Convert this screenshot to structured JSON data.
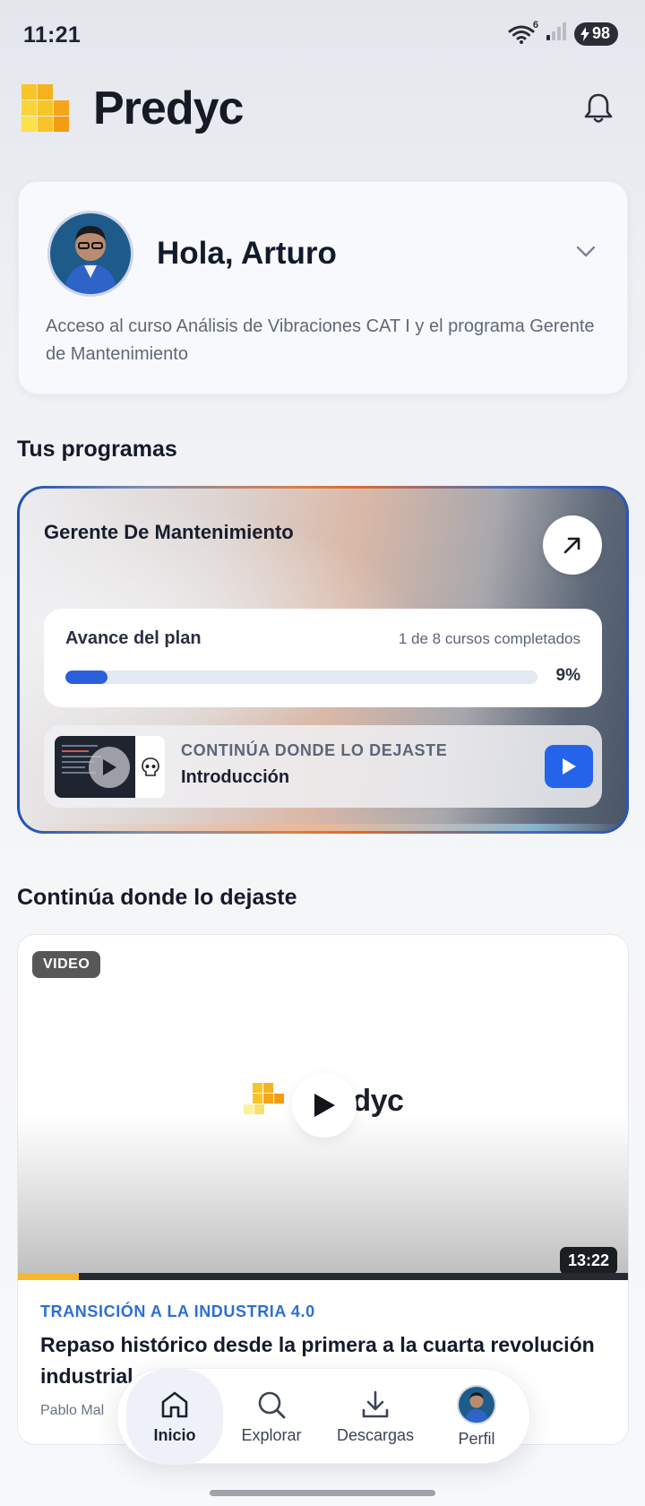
{
  "status_bar": {
    "time": "11:21",
    "wifi_label": "6",
    "battery": "98"
  },
  "header": {
    "brand": "Predyc"
  },
  "greeting": {
    "title": "Hola, Arturo",
    "description": "Acceso al curso Análisis de Vibraciones CAT I y el programa Gerente de Mantenimiento"
  },
  "programs": {
    "section_title": "Tus programas",
    "program": {
      "title": "Gerente De Mantenimiento",
      "progress_label": "Avance del plan",
      "progress_count": "1 de 8 cursos completados",
      "progress_percent_label": "9%",
      "progress_fraction": 0.09,
      "resume_kicker": "CONTINÚA DONDE LO DEJASTE",
      "resume_title": "Introducción"
    }
  },
  "continue": {
    "section_title": "Continúa donde lo dejaste",
    "video": {
      "badge": "VIDEO",
      "logo_text": "Predyc",
      "duration": "13:22",
      "watched_fraction": 0.1,
      "category": "TRANSICIÓN A LA INDUSTRIA 4.0",
      "title": "Repaso histórico desde la primera a la cuarta revolución industrial",
      "author": "Pablo Mal"
    }
  },
  "nav": {
    "items": [
      {
        "label": "Inicio",
        "icon": "home-icon"
      },
      {
        "label": "Explorar",
        "icon": "search-icon"
      },
      {
        "label": "Descargas",
        "icon": "download-icon"
      },
      {
        "label": "Perfil",
        "icon": "avatar"
      }
    ]
  },
  "colors": {
    "accent": "#2563eb",
    "brand_yellow": "#f5b82a",
    "text": "#141a2b"
  }
}
